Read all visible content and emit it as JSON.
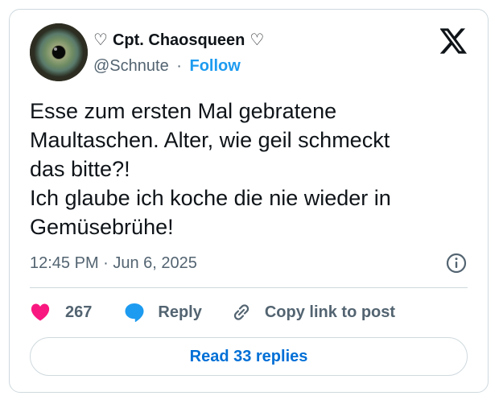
{
  "author": {
    "heart_left": "♡",
    "display_name": "Cpt. Chaosqueen",
    "heart_right": "♡",
    "handle": "@Schnute",
    "separator": "·",
    "follow_label": "Follow"
  },
  "tweet": {
    "text": "Esse zum ersten Mal gebratene\nMaultaschen. Alter, wie geil schmeckt\ndas bitte?!\nIch glaube ich koche die nie wieder in\nGemüsebrühe!",
    "timestamp": "12:45 PM · Jun 6, 2025"
  },
  "actions": {
    "like_count": "267",
    "reply_label": "Reply",
    "copy_label": "Copy link to post"
  },
  "read_replies_label": "Read 33 replies",
  "icons": {
    "logo": "x-logo-icon",
    "info": "info-icon",
    "like": "heart-icon",
    "reply": "speech-bubble-icon",
    "copy": "link-icon"
  },
  "colors": {
    "accent": "#1d9bf0",
    "like": "#f91880",
    "text": "#0f1419",
    "muted": "#536471",
    "border": "#cfd9de"
  }
}
